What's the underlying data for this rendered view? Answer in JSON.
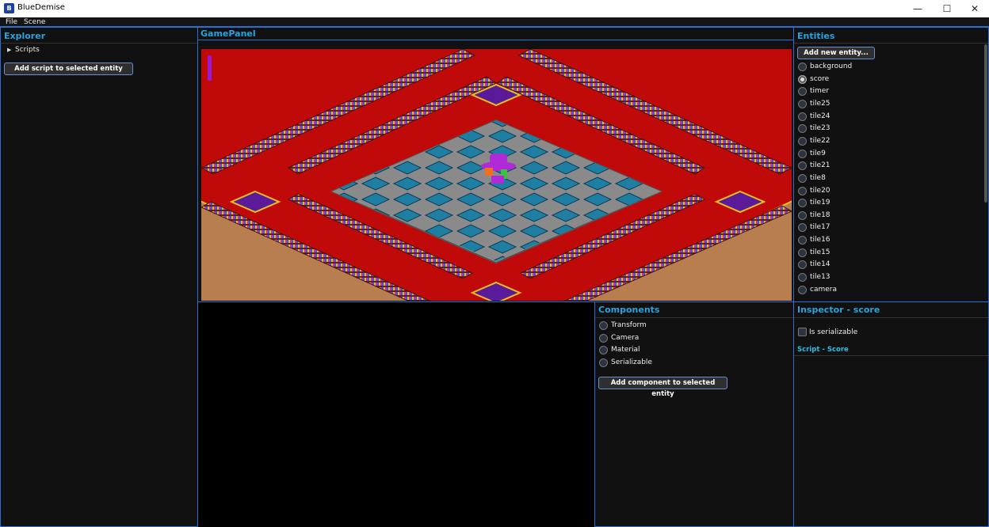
{
  "window": {
    "title": "BlueDemise",
    "icon": "app-logo-icon",
    "controls": [
      "—",
      "☐",
      "✕"
    ]
  },
  "menu": [
    "File",
    "Scene"
  ],
  "explorer": {
    "title": "Explorer",
    "tree": [
      {
        "label": "Scripts",
        "expanded": false
      }
    ],
    "add_script_label": "Add script to selected entity"
  },
  "game_panel": {
    "title": "GamePanel"
  },
  "entities": {
    "title": "Entities",
    "add_label": "Add new entity...",
    "items": [
      {
        "label": "background",
        "selected": false
      },
      {
        "label": "score",
        "selected": true
      },
      {
        "label": "timer",
        "selected": false
      },
      {
        "label": "tile25",
        "selected": false
      },
      {
        "label": "tile24",
        "selected": false
      },
      {
        "label": "tile23",
        "selected": false
      },
      {
        "label": "tile22",
        "selected": false
      },
      {
        "label": "tile9",
        "selected": false
      },
      {
        "label": "tile21",
        "selected": false
      },
      {
        "label": "tile8",
        "selected": false
      },
      {
        "label": "tile20",
        "selected": false
      },
      {
        "label": "tile19",
        "selected": false
      },
      {
        "label": "tile18",
        "selected": false
      },
      {
        "label": "tile17",
        "selected": false
      },
      {
        "label": "tile16",
        "selected": false
      },
      {
        "label": "tile15",
        "selected": false
      },
      {
        "label": "tile14",
        "selected": false
      },
      {
        "label": "tile13",
        "selected": false
      },
      {
        "label": "camera",
        "selected": false
      }
    ]
  },
  "components": {
    "title": "Components",
    "items": [
      "Transform",
      "Camera",
      "Material",
      "Serializable"
    ],
    "add_label": "Add component to selected entity"
  },
  "inspector": {
    "title": "Inspector - score",
    "serializable_label": "Is serializable",
    "script_label": "Script - Score"
  },
  "colors": {
    "accent": "#29a3e0",
    "border": "#2a6fd6",
    "carpet": "#c00a0a",
    "floor": "#b97e50",
    "water": "#1f7fa3"
  }
}
